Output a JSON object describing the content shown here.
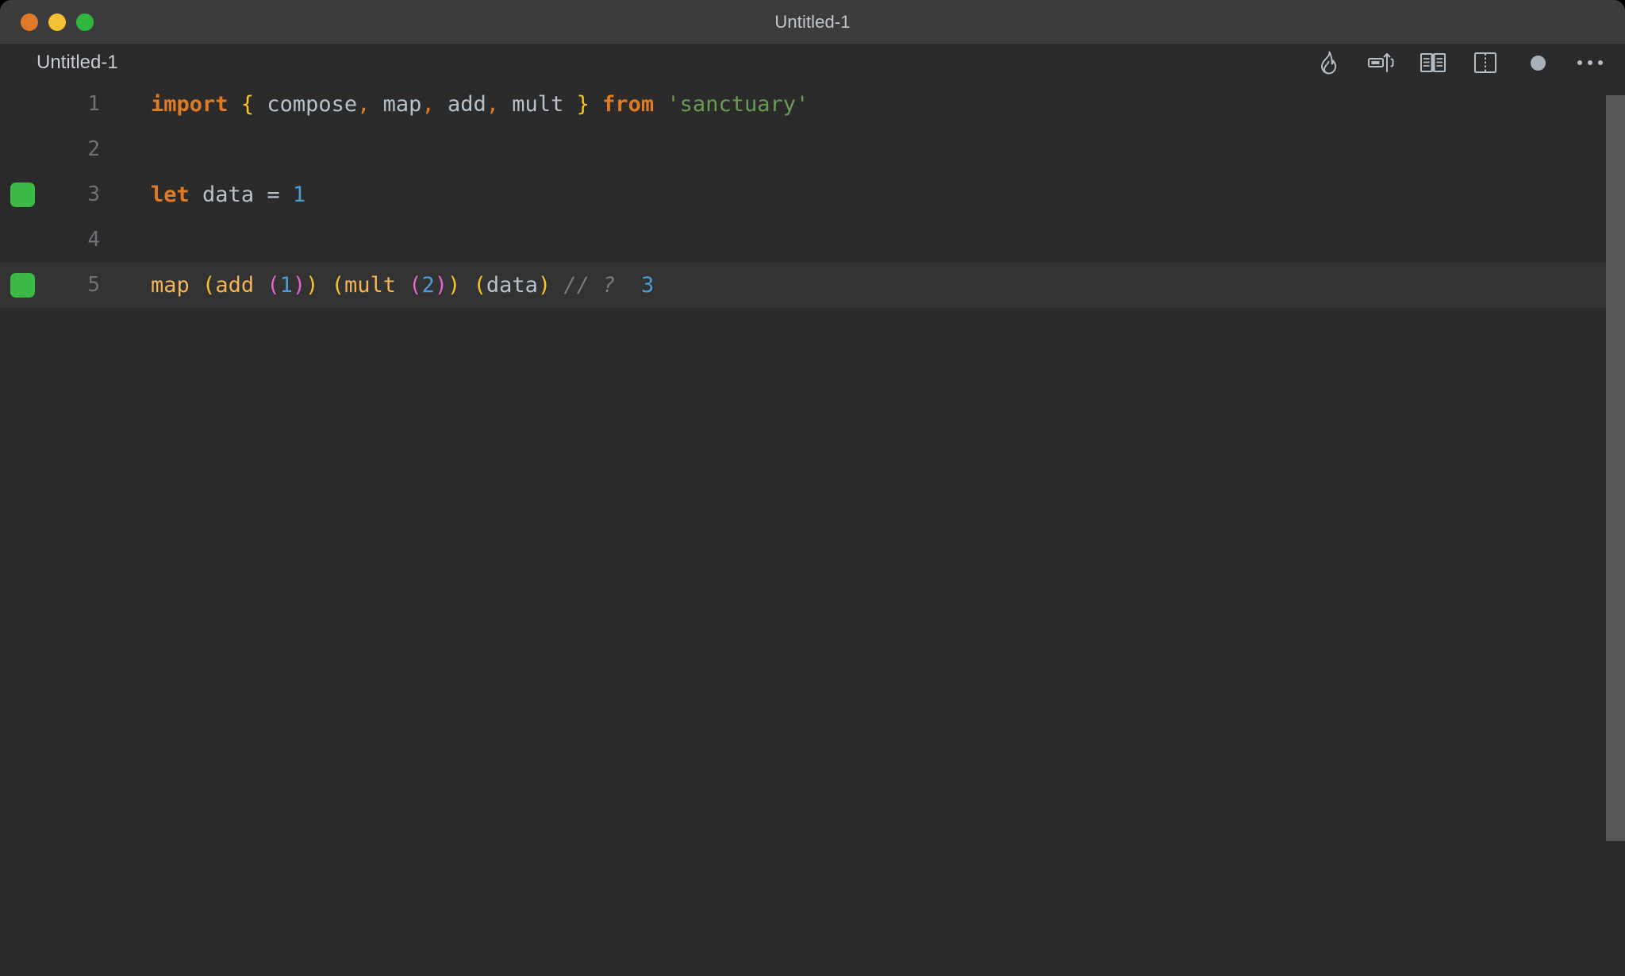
{
  "window": {
    "title": "Untitled-1",
    "traffic_lights": [
      {
        "name": "close",
        "color": "#e0792a"
      },
      {
        "name": "minimize",
        "color": "#f4c033"
      },
      {
        "name": "maximize",
        "color": "#2fb83d"
      }
    ]
  },
  "tab": {
    "label": "Untitled-1"
  },
  "toolbar": {
    "icons": [
      {
        "name": "flame-icon",
        "label": "Run / Quokka"
      },
      {
        "name": "run-inline-icon",
        "label": "Show Quokka Output"
      },
      {
        "name": "open-book-icon",
        "label": "Open Documentation"
      },
      {
        "name": "split-editor-icon",
        "label": "Split Editor"
      },
      {
        "name": "unsaved-dot-icon",
        "label": "Unsaved Changes"
      },
      {
        "name": "more-actions-icon",
        "label": "More Actions..."
      }
    ]
  },
  "editor": {
    "language": "javascript",
    "cursor_line": 5,
    "active_line": 5,
    "gutter_marker_color": "#3cba45",
    "lines": [
      {
        "number": "1",
        "marker": false,
        "active": false,
        "tokens": [
          {
            "t": "import",
            "c": "t-kw"
          },
          {
            "t": " ",
            "c": "t-id"
          },
          {
            "t": "{",
            "c": "t-brace"
          },
          {
            "t": " ",
            "c": "t-id"
          },
          {
            "t": "compose",
            "c": "t-id"
          },
          {
            "t": ",",
            "c": "t-punc"
          },
          {
            "t": " ",
            "c": "t-id"
          },
          {
            "t": "map",
            "c": "t-id"
          },
          {
            "t": ",",
            "c": "t-punc"
          },
          {
            "t": " ",
            "c": "t-id"
          },
          {
            "t": "add",
            "c": "t-id"
          },
          {
            "t": ",",
            "c": "t-punc"
          },
          {
            "t": " ",
            "c": "t-id"
          },
          {
            "t": "mult",
            "c": "t-id"
          },
          {
            "t": " ",
            "c": "t-id"
          },
          {
            "t": "}",
            "c": "t-brace"
          },
          {
            "t": " ",
            "c": "t-id"
          },
          {
            "t": "from",
            "c": "t-kw"
          },
          {
            "t": " ",
            "c": "t-id"
          },
          {
            "t": "'sanctuary'",
            "c": "t-str"
          }
        ],
        "plain": "import { compose, map, add, mult } from 'sanctuary'"
      },
      {
        "number": "2",
        "marker": false,
        "active": false,
        "tokens": [],
        "plain": ""
      },
      {
        "number": "3",
        "marker": true,
        "active": false,
        "tokens": [
          {
            "t": "let",
            "c": "t-kw"
          },
          {
            "t": " ",
            "c": "t-id"
          },
          {
            "t": "data",
            "c": "t-id"
          },
          {
            "t": " ",
            "c": "t-id"
          },
          {
            "t": "=",
            "c": "t-op"
          },
          {
            "t": " ",
            "c": "t-id"
          },
          {
            "t": "1",
            "c": "t-num"
          }
        ],
        "plain": "let data = 1"
      },
      {
        "number": "4",
        "marker": false,
        "active": false,
        "tokens": [],
        "plain": ""
      },
      {
        "number": "5",
        "marker": true,
        "active": true,
        "tokens": [
          {
            "t": "map",
            "c": "t-fn"
          },
          {
            "t": " ",
            "c": "t-id"
          },
          {
            "t": "(",
            "c": "t-par1"
          },
          {
            "t": "add",
            "c": "t-fn"
          },
          {
            "t": " ",
            "c": "t-id"
          },
          {
            "t": "(",
            "c": "t-par2"
          },
          {
            "t": "1",
            "c": "t-num"
          },
          {
            "t": ")",
            "c": "t-par2"
          },
          {
            "t": ")",
            "c": "t-par1"
          },
          {
            "t": " ",
            "c": "t-id"
          },
          {
            "t": "(",
            "c": "t-par1"
          },
          {
            "t": "mult",
            "c": "t-fn"
          },
          {
            "t": " ",
            "c": "t-id"
          },
          {
            "t": "(",
            "c": "t-par2"
          },
          {
            "t": "2",
            "c": "t-num"
          },
          {
            "t": ")",
            "c": "t-par2"
          },
          {
            "t": ")",
            "c": "t-par1"
          },
          {
            "t": " ",
            "c": "t-id"
          },
          {
            "t": "(",
            "c": "t-par1"
          },
          {
            "t": "data",
            "c": "t-id"
          },
          {
            "t": ")",
            "c": "t-par1"
          },
          {
            "t": " ",
            "c": "t-id"
          },
          {
            "t": "// ?",
            "c": "t-comment"
          },
          {
            "t": "  ",
            "c": "t-id"
          },
          {
            "t": "3",
            "c": "t-result"
          }
        ],
        "plain": "map (add (1)) (mult (2)) (data) // ?  3"
      }
    ]
  },
  "scrollbar": {
    "name": "vertical-scrollbar",
    "color": "#555759"
  },
  "theme": {
    "background": "#2b2b2b",
    "titlebar": "#3c3c3c",
    "active_line": "#333333",
    "keyword": "#e07b24",
    "identifier": "#b8c2cc",
    "string": "#6a9b55",
    "number": "#4a9ed4",
    "brace": "#f7c325",
    "function": "#f5b455",
    "bracket_level_1": "#f7c325",
    "bracket_level_2": "#e563d0",
    "comment": "#737b84",
    "line_number": "#6e7277"
  }
}
